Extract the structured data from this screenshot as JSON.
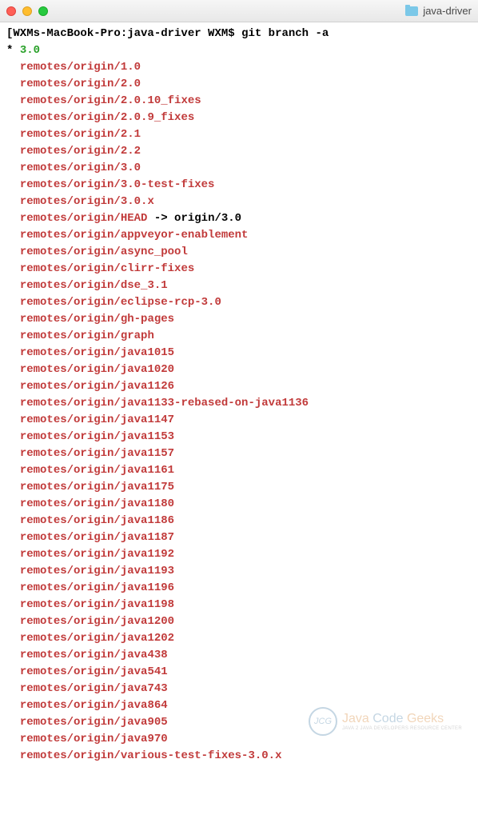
{
  "window": {
    "title": "java-driver"
  },
  "terminal": {
    "prompt": "[WXMs-MacBook-Pro:java-driver WXM$ ",
    "command": "git branch -a",
    "current_marker": "* ",
    "current_branch": "3.0",
    "indent": "  ",
    "head_line_prefix": "remotes/origin/HEAD",
    "head_line_suffix": " -> origin/3.0",
    "remotes": [
      "remotes/origin/1.0",
      "remotes/origin/2.0",
      "remotes/origin/2.0.10_fixes",
      "remotes/origin/2.0.9_fixes",
      "remotes/origin/2.1",
      "remotes/origin/2.2",
      "remotes/origin/3.0",
      "remotes/origin/3.0-test-fixes",
      "remotes/origin/3.0.x"
    ],
    "remotes_after_head": [
      "remotes/origin/appveyor-enablement",
      "remotes/origin/async_pool",
      "remotes/origin/clirr-fixes",
      "remotes/origin/dse_3.1",
      "remotes/origin/eclipse-rcp-3.0",
      "remotes/origin/gh-pages",
      "remotes/origin/graph",
      "remotes/origin/java1015",
      "remotes/origin/java1020",
      "remotes/origin/java1126",
      "remotes/origin/java1133-rebased-on-java1136",
      "remotes/origin/java1147",
      "remotes/origin/java1153",
      "remotes/origin/java1157",
      "remotes/origin/java1161",
      "remotes/origin/java1175",
      "remotes/origin/java1180",
      "remotes/origin/java1186",
      "remotes/origin/java1187",
      "remotes/origin/java1192",
      "remotes/origin/java1193",
      "remotes/origin/java1196",
      "remotes/origin/java1198",
      "remotes/origin/java1200",
      "remotes/origin/java1202",
      "remotes/origin/java438",
      "remotes/origin/java541",
      "remotes/origin/java743",
      "remotes/origin/java864",
      "remotes/origin/java905",
      "remotes/origin/java970",
      "remotes/origin/various-test-fixes-3.0.x"
    ]
  },
  "watermark": {
    "logo_text": "JCG",
    "brand_java": "Java",
    "brand_code": " Code ",
    "brand_geeks": "Geeks",
    "tagline": "JAVA 2 JAVA DEVELOPERS RESOURCE CENTER"
  }
}
